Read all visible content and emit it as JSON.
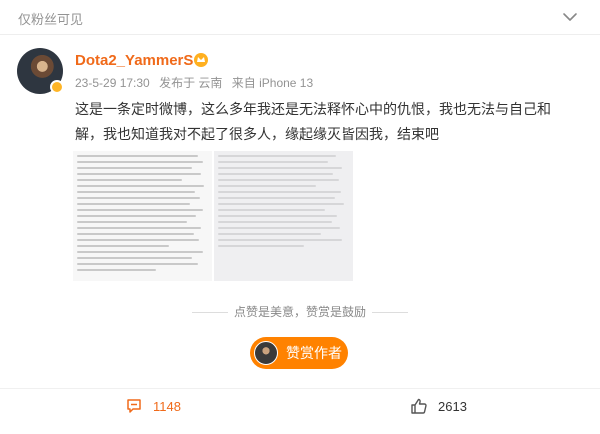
{
  "post": {
    "visibility": "仅粉丝可见",
    "author": "Dota2_YammerS",
    "date": "23-5-29 17:30",
    "posted_from": "发布于 云南",
    "source": "来自 iPhone 13",
    "text": "这是一条定时微博，这么多年我还是无法释怀心中的仇恨，我也无法与自己和解，我也知道我对不起了很多人，缘起缘灭皆因我，结束吧",
    "images": [
      "text-screenshot-1",
      "text-screenshot-2"
    ]
  },
  "reward": {
    "hint": "点赞是美意，赞赏是鼓励",
    "button_label": "赞赏作者"
  },
  "actions": {
    "comment_count": "1148",
    "like_count": "2613"
  },
  "colors": {
    "accent": "#f06a1a",
    "reward": "#ff8200",
    "muted": "#939393"
  },
  "icons": [
    "chevron-down-icon",
    "vip-crown-icon",
    "comment-icon",
    "like-icon"
  ]
}
